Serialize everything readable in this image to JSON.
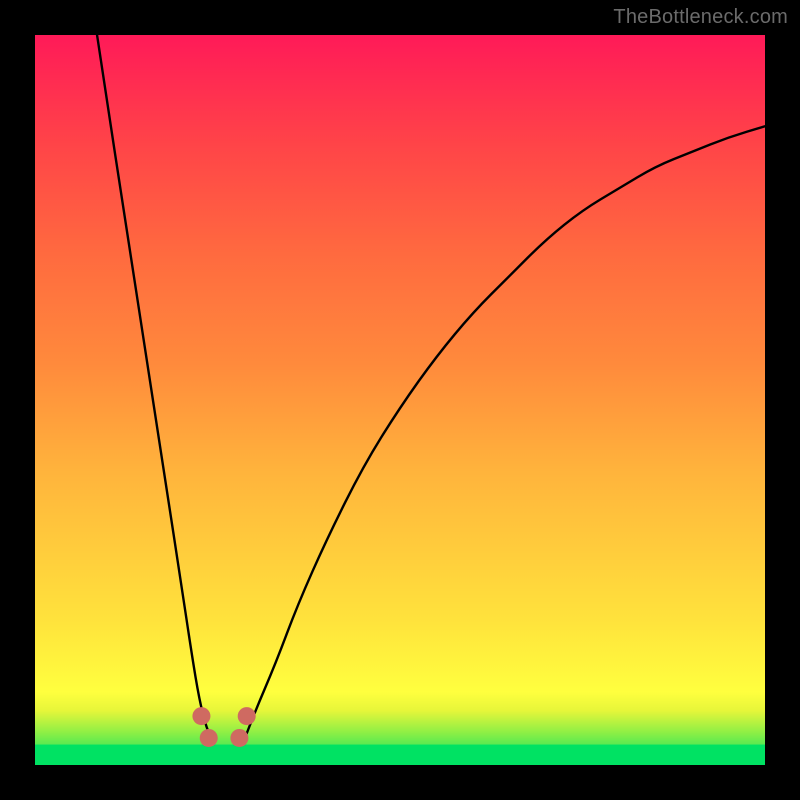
{
  "watermark": "TheBottleneck.com",
  "chart_data": {
    "type": "line",
    "title": "",
    "xlabel": "",
    "ylabel": "",
    "xlim": [
      0,
      1
    ],
    "ylim": [
      0,
      1
    ],
    "grid": false,
    "legend": false,
    "annotations": [],
    "background_gradient_stops": [
      {
        "pos": 0.0,
        "color": "#00e263"
      },
      {
        "pos": 0.045,
        "color": "#8fef45"
      },
      {
        "pos": 0.075,
        "color": "#e7f63a"
      },
      {
        "pos": 0.1,
        "color": "#ffff3e"
      },
      {
        "pos": 0.2,
        "color": "#ffe23c"
      },
      {
        "pos": 0.4,
        "color": "#ffb43c"
      },
      {
        "pos": 0.55,
        "color": "#ff8a3c"
      },
      {
        "pos": 0.7,
        "color": "#ff6a3f"
      },
      {
        "pos": 0.85,
        "color": "#ff4448"
      },
      {
        "pos": 1.0,
        "color": "#ff1a58"
      }
    ],
    "series": [
      {
        "name": "left-branch",
        "note": "Steep descending branch from top-left into the dip",
        "x": [
          0.085,
          0.1,
          0.12,
          0.14,
          0.16,
          0.18,
          0.2,
          0.215,
          0.225,
          0.235,
          0.245
        ],
        "y": [
          1.0,
          0.9,
          0.77,
          0.64,
          0.51,
          0.38,
          0.25,
          0.15,
          0.09,
          0.05,
          0.03
        ]
      },
      {
        "name": "right-branch",
        "note": "Slow-rising branch from the dip toward upper-right",
        "x": [
          0.285,
          0.3,
          0.33,
          0.36,
          0.4,
          0.45,
          0.5,
          0.55,
          0.6,
          0.65,
          0.7,
          0.75,
          0.8,
          0.85,
          0.9,
          0.95,
          1.0
        ],
        "y": [
          0.03,
          0.07,
          0.14,
          0.22,
          0.31,
          0.41,
          0.49,
          0.56,
          0.62,
          0.67,
          0.72,
          0.76,
          0.79,
          0.82,
          0.84,
          0.86,
          0.875
        ]
      }
    ],
    "markers": [
      {
        "x": 0.228,
        "y": 0.067
      },
      {
        "x": 0.238,
        "y": 0.037
      },
      {
        "x": 0.28,
        "y": 0.037
      },
      {
        "x": 0.29,
        "y": 0.067
      }
    ],
    "marker_style": {
      "color": "#cf6a61",
      "radius_px": 9
    },
    "bottom_band": {
      "from_y": 0.0,
      "to_y": 0.028,
      "color": "#00e263"
    }
  }
}
